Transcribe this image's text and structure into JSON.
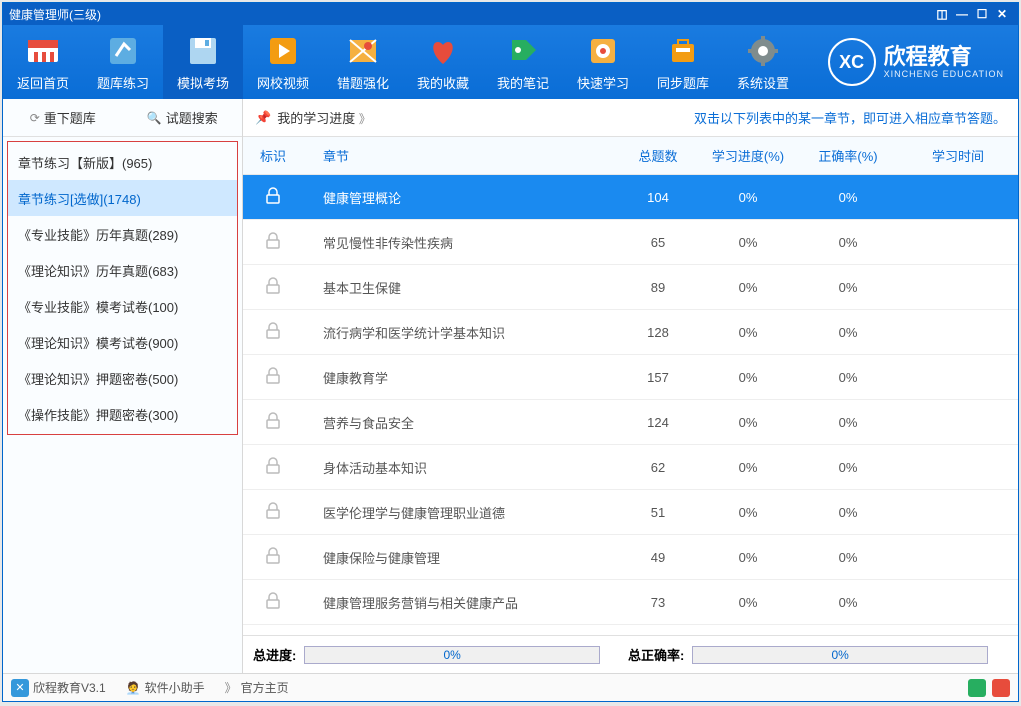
{
  "title": "健康管理师(三级)",
  "toolbar": [
    {
      "label": "返回首页"
    },
    {
      "label": "题库练习"
    },
    {
      "label": "模拟考场"
    },
    {
      "label": "网校视频"
    },
    {
      "label": "错题强化"
    },
    {
      "label": "我的收藏"
    },
    {
      "label": "我的笔记"
    },
    {
      "label": "快速学习"
    },
    {
      "label": "同步题库"
    },
    {
      "label": "系统设置"
    }
  ],
  "logo": {
    "mark": "XC",
    "text": "欣程教育",
    "sub": "XINCHENG EDUCATION"
  },
  "side_tools": {
    "redownload": "重下题库",
    "search": "试题搜索"
  },
  "side_items": [
    "章节练习【新版】(965)",
    "章节练习[选做](1748)",
    "《专业技能》历年真题(289)",
    "《理论知识》历年真题(683)",
    "《专业技能》模考试卷(100)",
    "《理论知识》模考试卷(900)",
    "《理论知识》押题密卷(500)",
    "《操作技能》押题密卷(300)"
  ],
  "main_top": {
    "progress_label": "我的学习进度",
    "hint": "双击以下列表中的某一章节，即可进入相应章节答题。"
  },
  "columns": {
    "flag": "标识",
    "chapter": "章节",
    "total": "总题数",
    "progress": "学习进度(%)",
    "accuracy": "正确率(%)",
    "time": "学习时间"
  },
  "rows": [
    {
      "chapter": "健康管理概论",
      "total": "104",
      "progress": "0%",
      "accuracy": "0%"
    },
    {
      "chapter": "常见慢性非传染性疾病",
      "total": "65",
      "progress": "0%",
      "accuracy": "0%"
    },
    {
      "chapter": "基本卫生保健",
      "total": "89",
      "progress": "0%",
      "accuracy": "0%"
    },
    {
      "chapter": "流行病学和医学统计学基本知识",
      "total": "128",
      "progress": "0%",
      "accuracy": "0%"
    },
    {
      "chapter": "健康教育学",
      "total": "157",
      "progress": "0%",
      "accuracy": "0%"
    },
    {
      "chapter": "营养与食品安全",
      "total": "124",
      "progress": "0%",
      "accuracy": "0%"
    },
    {
      "chapter": "身体活动基本知识",
      "total": "62",
      "progress": "0%",
      "accuracy": "0%"
    },
    {
      "chapter": "医学伦理学与健康管理职业道德",
      "total": "51",
      "progress": "0%",
      "accuracy": "0%"
    },
    {
      "chapter": "健康保险与健康管理",
      "total": "49",
      "progress": "0%",
      "accuracy": "0%"
    },
    {
      "chapter": "健康管理服务营销与相关健康产品",
      "total": "73",
      "progress": "0%",
      "accuracy": "0%"
    }
  ],
  "footer": {
    "total_progress_label": "总进度:",
    "total_progress_val": "0%",
    "total_accuracy_label": "总正确率:",
    "total_accuracy_val": "0%"
  },
  "status": {
    "app": "欣程教育V3.1",
    "helper": "软件小助手",
    "home": "官方主页"
  }
}
